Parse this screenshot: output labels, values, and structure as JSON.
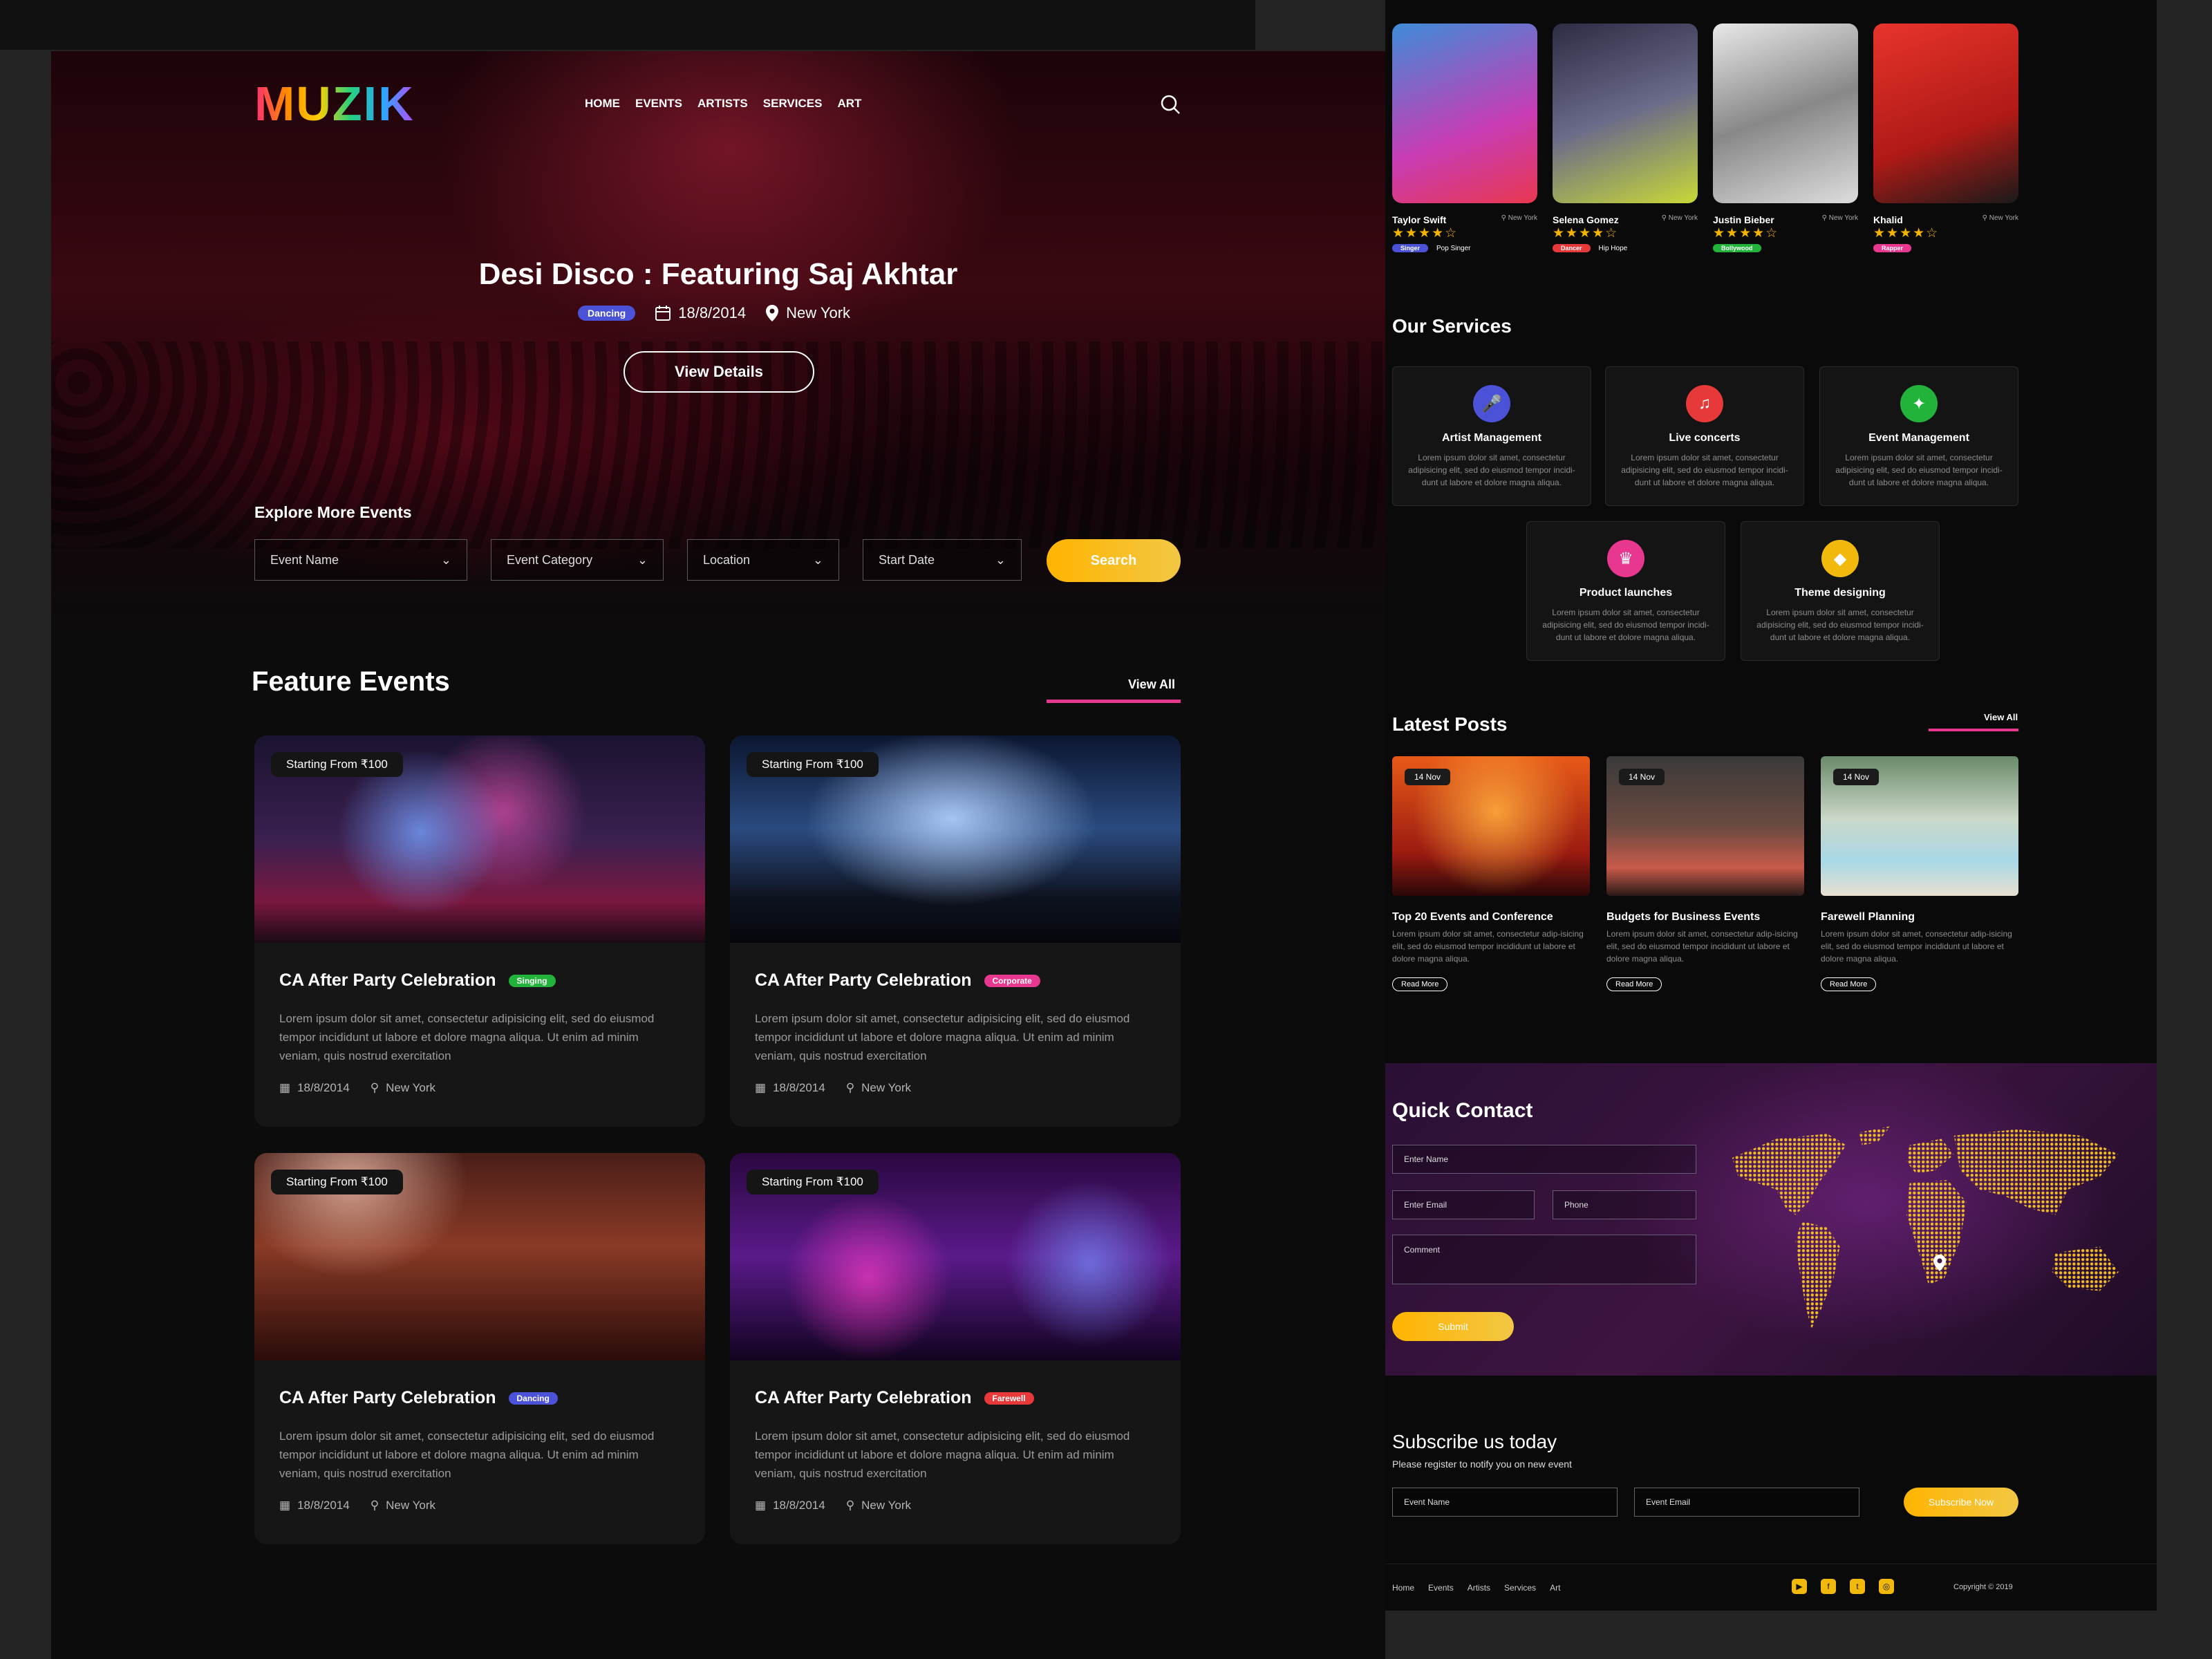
{
  "brand": {
    "logo": "MUZIK"
  },
  "nav": {
    "items": [
      "HOME",
      "EVENTS",
      "ARTISTS",
      "SERVICES",
      "ART"
    ]
  },
  "hero": {
    "title": "Desi Disco : Featuring Saj Akhtar",
    "badge": "Dancing",
    "date": "18/8/2014",
    "location": "New York",
    "button": "View Details"
  },
  "explore": {
    "title": "Explore More Events",
    "fields": [
      "Event Name",
      "Event Category",
      "Location",
      "Start Date"
    ],
    "search": "Search"
  },
  "featured": {
    "title": "Feature Events",
    "view_all": "View All",
    "cards": [
      {
        "price": "Starting From ₹100",
        "title": "CA After Party  Celebration",
        "tag": "Singing",
        "tag_color": "#22b33a",
        "desc": "Lorem ipsum dolor sit amet, consectetur adipisicing elit, sed do eiusmod tempor incididunt ut labore et dolore magna aliqua. Ut enim ad minim veniam, quis nostrud exercitation",
        "date": "18/8/2014",
        "location": "New York"
      },
      {
        "price": "Starting From ₹100",
        "title": "CA After Party  Celebration",
        "tag": "Corporate",
        "tag_color": "#e8378f",
        "desc": "Lorem ipsum dolor sit amet, consectetur adipisicing elit, sed do eiusmod tempor incididunt ut labore et dolore magna aliqua. Ut enim ad minim veniam, quis nostrud exercitation",
        "date": "18/8/2014",
        "location": "New York"
      },
      {
        "price": "Starting From ₹100",
        "title": "CA After Party  Celebration",
        "tag": "Dancing",
        "tag_color": "#4b52d8",
        "desc": "Lorem ipsum dolor sit amet, consectetur adipisicing elit, sed do eiusmod tempor incididunt ut labore et dolore magna aliqua. Ut enim ad minim veniam, quis nostrud exercitation",
        "date": "18/8/2014",
        "location": "New York"
      },
      {
        "price": "Starting From ₹100",
        "title": "CA After Party  Celebration",
        "tag": "Farewell",
        "tag_color": "#e8393a",
        "desc": "Lorem ipsum dolor sit amet, consectetur adipisicing elit, sed do eiusmod tempor incididunt ut labore et dolore magna aliqua. Ut enim ad minim veniam, quis nostrud exercitation",
        "date": "18/8/2014",
        "location": "New York"
      }
    ]
  },
  "artists": [
    {
      "name": "Taylor Swift",
      "location": "New York",
      "stars": "★★★★☆",
      "tag": "Singer",
      "tag_color": "#4b52d8",
      "genre": "Pop Singer"
    },
    {
      "name": "Selena Gomez",
      "location": "New York",
      "stars": "★★★★☆",
      "tag": "Dancer",
      "tag_color": "#e8393a",
      "genre": "Hip Hope"
    },
    {
      "name": "Justin Bieber",
      "location": "New York",
      "stars": "★★★★☆",
      "tag": "Bollywood",
      "tag_color": "#22b33a",
      "genre": ""
    },
    {
      "name": "Khalid",
      "location": "New York",
      "stars": "★★★★☆",
      "tag": "Rapper",
      "tag_color": "#e8378f",
      "genre": ""
    }
  ],
  "services": {
    "title": "Our Services",
    "items": [
      {
        "title": "Artist Management",
        "icon": "microphone-icon",
        "color": "#4b52d8",
        "desc": "Lorem ipsum dolor sit amet, consectetur adipisicing elit, sed do eiusmod tempor incidi-dunt ut labore et dolore magna aliqua."
      },
      {
        "title": "Live concerts",
        "icon": "concert-icon",
        "color": "#e8393a",
        "desc": "Lorem ipsum dolor sit amet, consectetur adipisicing elit, sed do eiusmod tempor incidi-dunt ut labore et dolore magna aliqua."
      },
      {
        "title": "Event Management",
        "icon": "event-icon",
        "color": "#22b33a",
        "desc": "Lorem ipsum dolor sit amet, consectetur adipisicing elit, sed do eiusmod tempor incidi-dunt ut labore et dolore magna aliqua."
      },
      {
        "title": "Product launches",
        "icon": "launch-icon",
        "color": "#e8378f",
        "desc": "Lorem ipsum dolor sit amet, consectetur adipisicing elit, sed do eiusmod tempor incidi-dunt ut labore et dolore magna aliqua."
      },
      {
        "title": "Theme designing",
        "icon": "theme-icon",
        "color": "#f2b90d",
        "desc": "Lorem ipsum dolor sit amet, consectetur adipisicing elit, sed do eiusmod tempor incidi-dunt ut labore et dolore magna aliqua."
      }
    ]
  },
  "posts": {
    "title": "Latest Posts",
    "view_all": "View All",
    "items": [
      {
        "date": "14 Nov",
        "title": "Top 20 Events and Conference",
        "desc": "Lorem ipsum dolor sit amet, consectetur adip-isicing elit, sed do eiusmod tempor incididunt ut labore et dolore magna aliqua.",
        "read_more": "Read More"
      },
      {
        "date": "14 Nov",
        "title": "Budgets for Business Events",
        "desc": "Lorem ipsum dolor sit amet, consectetur adip-isicing elit, sed do eiusmod tempor incididunt ut labore et dolore magna aliqua.",
        "read_more": "Read More"
      },
      {
        "date": "14 Nov",
        "title": "Farewell Planning",
        "desc": "Lorem ipsum dolor sit amet, consectetur adip-isicing elit, sed do eiusmod tempor incididunt ut labore et dolore magna aliqua.",
        "read_more": "Read More"
      }
    ]
  },
  "contact": {
    "title": "Quick Contact",
    "name": "Enter Name",
    "email": "Enter Email",
    "phone": "Phone",
    "comment": "Comment",
    "submit": "Submit"
  },
  "subscribe": {
    "title": "Subscribe us today",
    "subtitle": "Please register to notify you on new event",
    "name": "Event Name",
    "email": "Event Email",
    "button": "Subscribe Now"
  },
  "footer": {
    "links": [
      "Home",
      "Events",
      "Artists",
      "Services",
      "Art"
    ],
    "copyright": "Copyright © 2019",
    "social": [
      "youtube-icon",
      "facebook-icon",
      "twitter-icon",
      "instagram-icon"
    ]
  }
}
